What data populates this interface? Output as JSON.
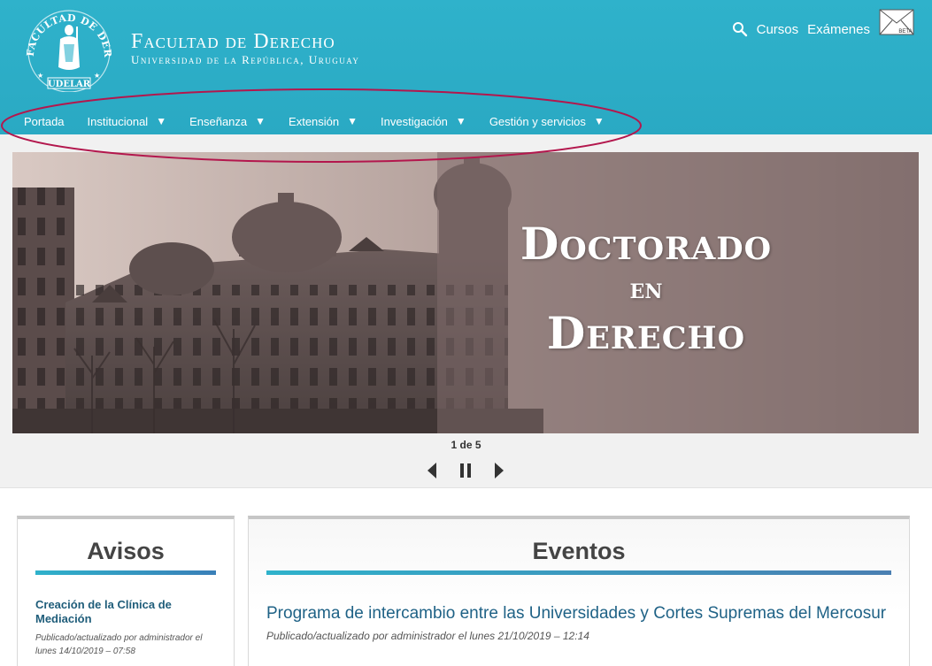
{
  "header": {
    "seal_text": "FACULTAD DE DERECHO",
    "seal_bottom": "UDELAR",
    "title": "Facultad de Derecho",
    "subtitle": "Universidad de la República, Uruguay",
    "toplinks": {
      "cursos": "Cursos",
      "examenes": "Exámenes"
    },
    "mail_badge": "BETA",
    "search_icon": "search-icon",
    "mail_icon": "mail-icon"
  },
  "nav": {
    "items": [
      {
        "label": "Portada"
      },
      {
        "label": "Institucional",
        "arrow": "▼"
      },
      {
        "label": "Enseñanza",
        "arrow": "▼"
      },
      {
        "label": "Extensión",
        "arrow": "▼"
      },
      {
        "label": "Investigación",
        "arrow": "▼"
      },
      {
        "label": "Gestión y servicios",
        "arrow": "▼"
      }
    ]
  },
  "slider": {
    "line1": "Doctorado",
    "line2": "en",
    "line3": "Derecho",
    "counter": "1 de 5",
    "icons": [
      "prev-icon",
      "pause-icon",
      "next-icon"
    ]
  },
  "avisos": {
    "title": "Avisos",
    "item": {
      "title": "Creación de la Clínica de Mediación",
      "meta": "Publicado/actualizado por administrador el lunes 14/10/2019 – 07:58"
    }
  },
  "eventos": {
    "title": "Eventos",
    "item": {
      "title": "Programa de intercambio entre las Universidades y Cortes Supremas del Mercosur",
      "meta": "Publicado/actualizado por administrador el lunes 21/10/2019 – 12:14"
    }
  },
  "colors": {
    "header": "#2fb2cb",
    "annotation_oval": "#b3174d",
    "link": "#1f6286"
  }
}
